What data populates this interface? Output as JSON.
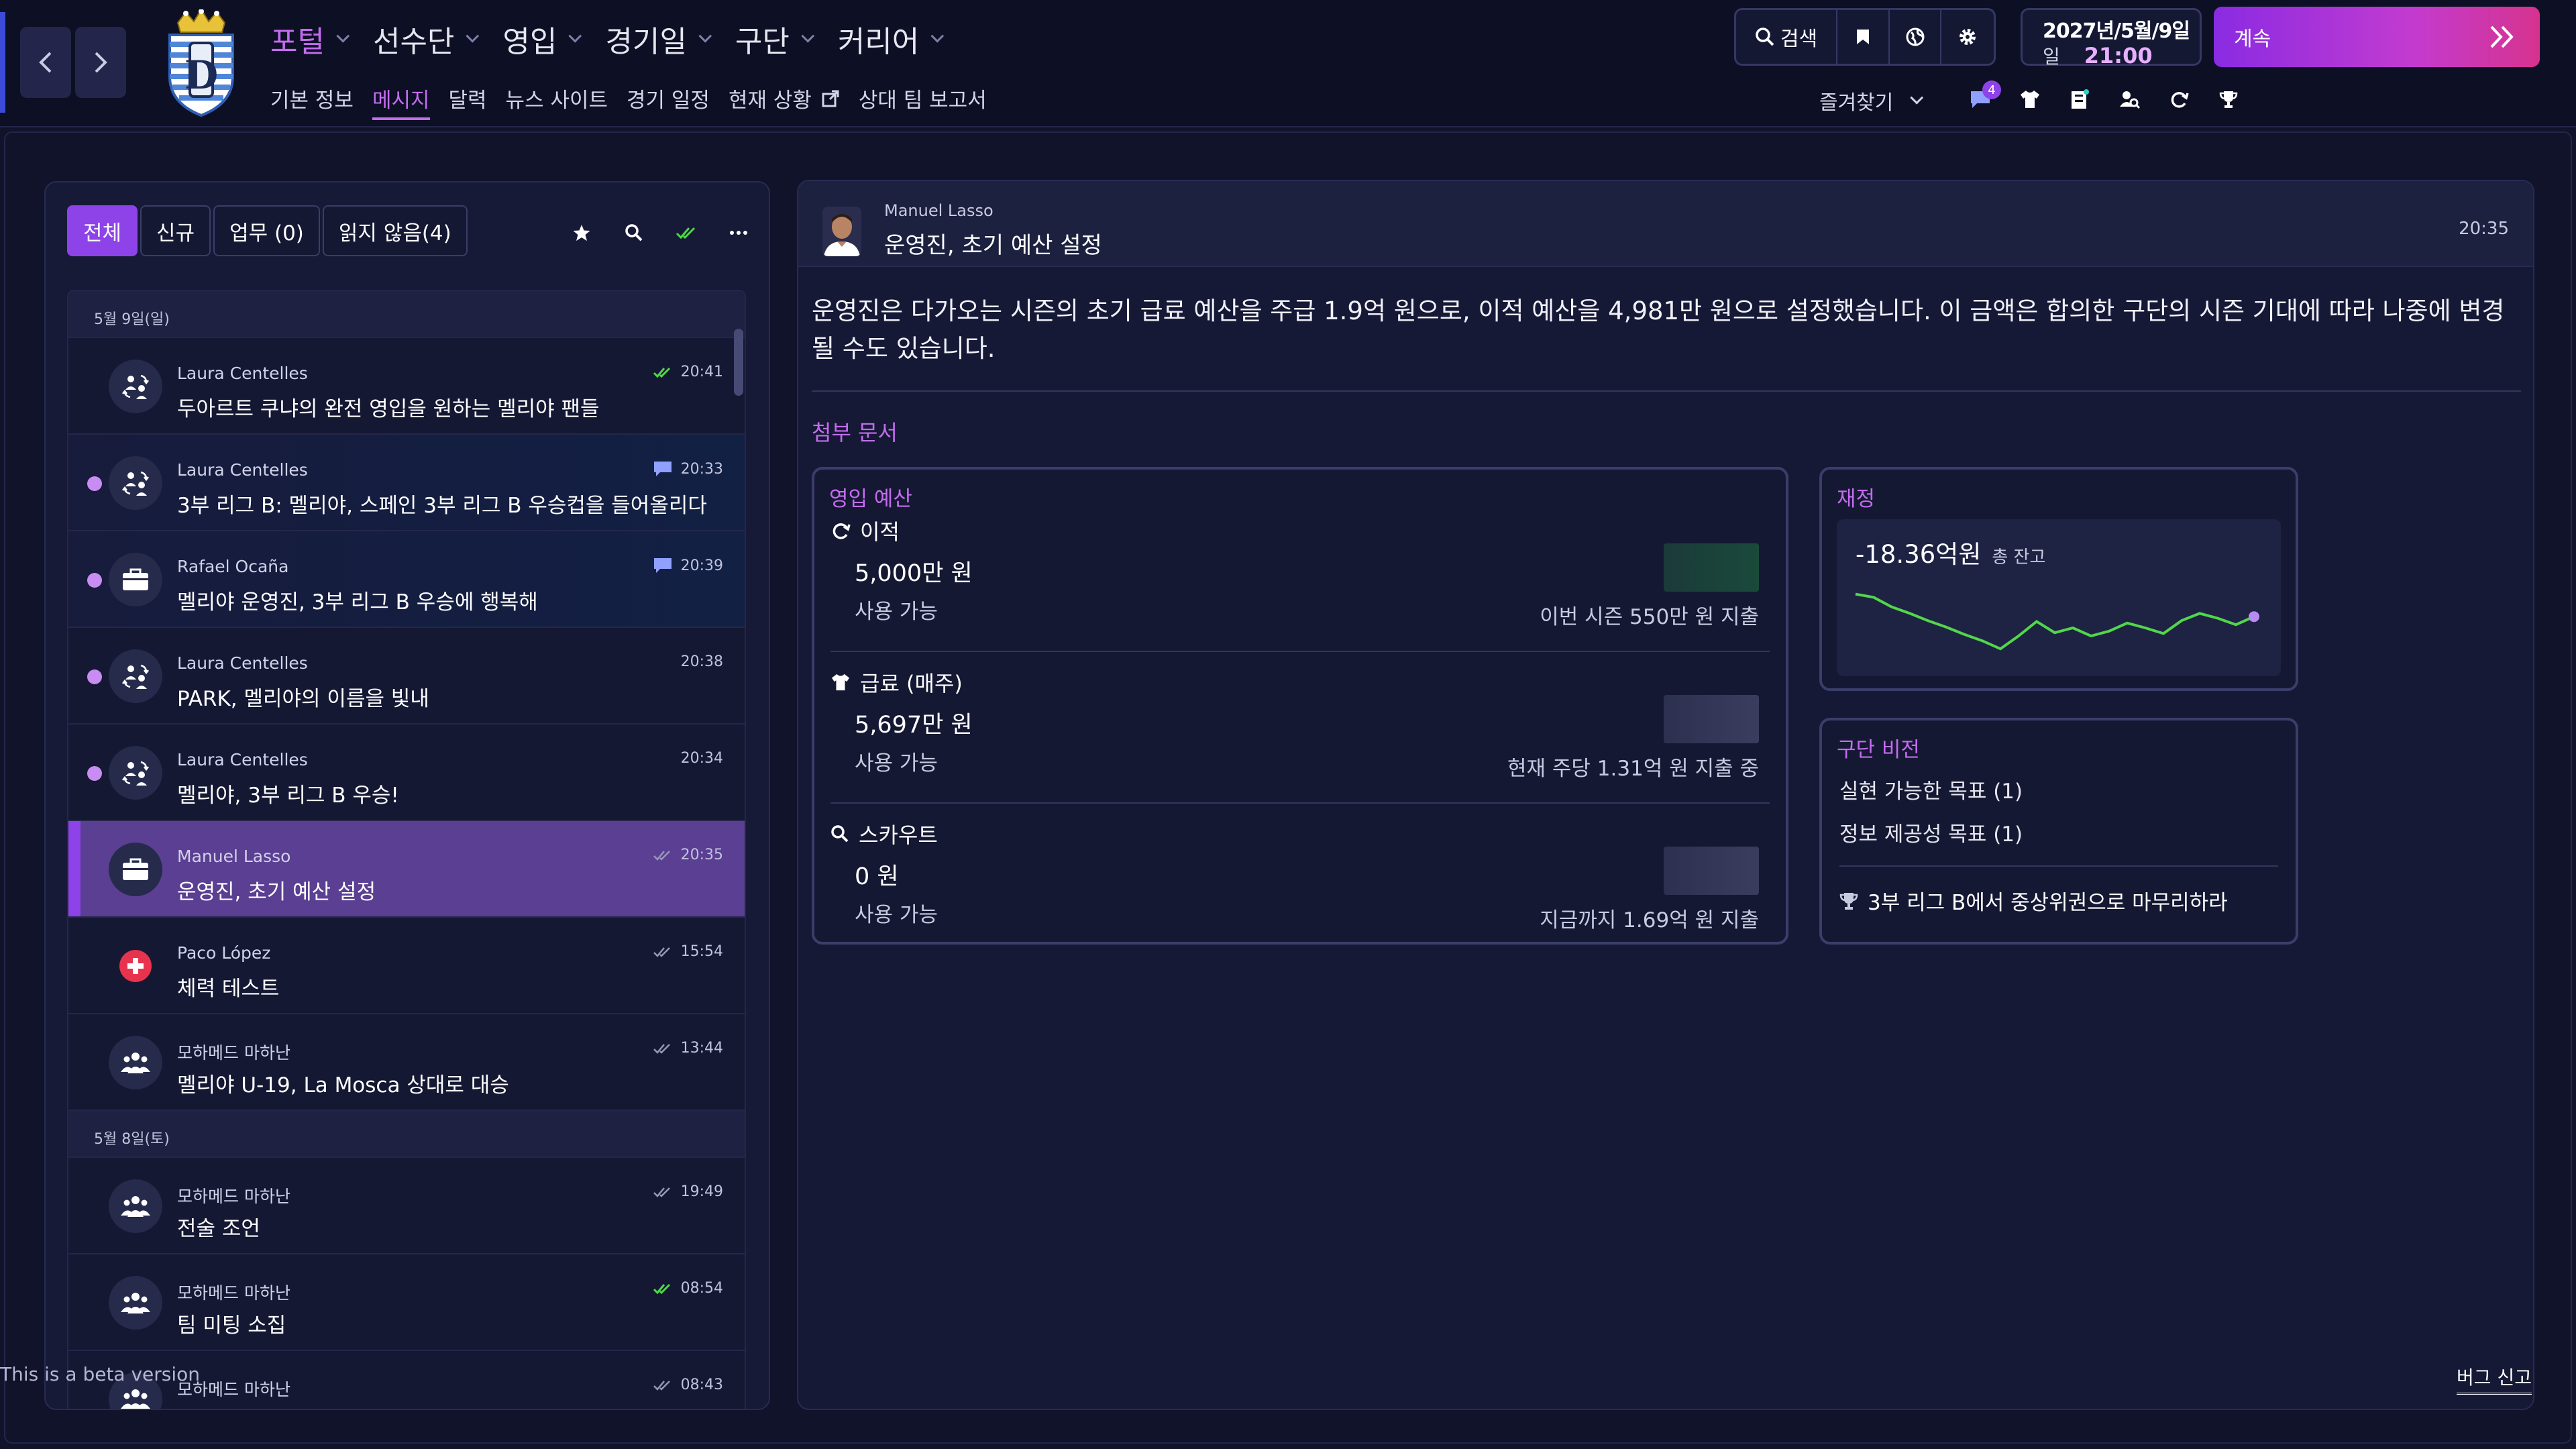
{
  "nav": {
    "main": [
      {
        "label": "포털",
        "active": true
      },
      {
        "label": "선수단"
      },
      {
        "label": "영입"
      },
      {
        "label": "경기일"
      },
      {
        "label": "구단"
      },
      {
        "label": "커리어"
      }
    ],
    "sub": [
      {
        "label": "기본 정보"
      },
      {
        "label": "메시지",
        "active": true
      },
      {
        "label": "달력"
      },
      {
        "label": "뉴스 사이트"
      },
      {
        "label": "경기 일정"
      },
      {
        "label": "현재 상황"
      },
      {
        "label": "상대 팀 보고서"
      }
    ],
    "external_icon": "external-link-icon"
  },
  "toolbar": {
    "search_label": "검색",
    "date_line": "2027년/5월/9일",
    "date_suffix": "일",
    "time": "21:00",
    "continue_label": "계속",
    "favorites_label": "즐겨찾기",
    "notification_count": "4"
  },
  "inbox": {
    "filters": [
      "전체",
      "신규",
      "업무 (0)",
      "읽지 않음(4)"
    ],
    "days": [
      {
        "date": "5월 9일(일)",
        "messages": [
          {
            "sender": "Laura Centelles",
            "subject": "두아르트 쿠냐의 완전 영입을 원하는 멜리야 팬들",
            "time": "20:41",
            "status": "read-green",
            "icon": "transfer-icon",
            "unread": false
          },
          {
            "sender": "Laura Centelles",
            "subject": "3부 리그 B: 멜리야, 스페인 3부 리그 B 우승컵을 들어올리다",
            "time": "20:33",
            "status": "comment",
            "icon": "transfer-icon",
            "unread": true,
            "tinted": true
          },
          {
            "sender": "Rafael Ocaña",
            "subject": "멜리야 운영진, 3부 리그 B 우승에 행복해",
            "time": "20:39",
            "status": "comment",
            "icon": "briefcase-icon",
            "unread": true,
            "tinted": true
          },
          {
            "sender": "Laura Centelles",
            "subject": "PARK, 멜리야의 이름을 빛내",
            "time": "20:38",
            "status": "none",
            "icon": "transfer-icon",
            "unread": true
          },
          {
            "sender": "Laura Centelles",
            "subject": "멜리야, 3부 리그 B 우승!",
            "time": "20:34",
            "status": "none",
            "icon": "transfer-icon",
            "unread": true
          },
          {
            "sender": "Manuel Lasso",
            "subject": "운영진, 초기 예산 설정",
            "time": "20:35",
            "status": "read-grey",
            "icon": "briefcase-icon",
            "unread": false,
            "selected": true
          },
          {
            "sender": "Paco López",
            "subject": "체력 테스트",
            "time": "15:54",
            "status": "read-grey",
            "icon": "medical-icon",
            "unread": false
          },
          {
            "sender": "모하메드 마하난",
            "subject": "멜리야 U-19, La Mosca 상대로 대승",
            "time": "13:44",
            "status": "read-grey",
            "icon": "staff-icon",
            "unread": false
          }
        ]
      },
      {
        "date": "5월 8일(토)",
        "messages": [
          {
            "sender": "모하메드 마하난",
            "subject": "전술 조언",
            "time": "19:49",
            "status": "read-grey",
            "icon": "staff-icon",
            "unread": false
          },
          {
            "sender": "모하메드 마하난",
            "subject": "팀 미팅 소집",
            "time": "08:54",
            "status": "read-green",
            "icon": "staff-icon",
            "unread": false
          },
          {
            "sender": "모하메드 마하난",
            "subject": "",
            "time": "08:43",
            "status": "read-grey",
            "icon": "staff-icon",
            "unread": false
          }
        ]
      }
    ]
  },
  "detail": {
    "from": "Manuel Lasso",
    "subject": "운영진, 초기 예산 설정",
    "time": "20:35",
    "body": "운영진은 다가오는 시즌의 초기 급료 예산을 주급 1.9억 원으로, 이적 예산을 4,981만 원으로 설정했습니다. 이 금액은 합의한 구단의 시즌 기대에 따라 나중에 변경될 수도 있습니다.",
    "attachments_title": "첨부 문서",
    "budget": {
      "title": "영입 예산",
      "sections": [
        {
          "label": "이적",
          "amount": "5,000만 원",
          "available": "사용 가능",
          "spend": "이번 시즌 550만 원 지출",
          "icon": "refresh-icon"
        },
        {
          "label": "급료 (매주)",
          "amount": "5,697만 원",
          "available": "사용 가능",
          "spend": "현재 주당 1.31억 원 지출 중",
          "icon": "shirt-icon"
        },
        {
          "label": "스카우트",
          "amount": "0 원",
          "available": "사용 가능",
          "spend": "지금까지 1.69억 원 지출",
          "icon": "search-icon"
        }
      ]
    },
    "finance": {
      "title": "재정",
      "value": "-18.36억원",
      "value_label": "총 잔고",
      "trend": [
        0.82,
        0.78,
        0.66,
        0.58,
        0.49,
        0.41,
        0.32,
        0.24,
        0.14,
        0.3,
        0.48,
        0.34,
        0.4,
        0.3,
        0.36,
        0.46,
        0.4,
        0.33,
        0.49,
        0.58,
        0.52,
        0.44,
        0.54
      ]
    },
    "vision": {
      "title": "구단 비전",
      "items": [
        "실현 가능한 목표 (1)",
        "정보 제공성 목표 (1)"
      ],
      "goal": "3부 리그 B에서 중상위권으로 마무리하라"
    }
  },
  "footer": {
    "beta": "This is a beta version",
    "bug": "버그 신고"
  },
  "colors": {
    "accent": "#c46cf0",
    "primary": "#8d43e8",
    "background": "#11132b",
    "panel": "#171a36",
    "chart_line": "#52d64b"
  }
}
